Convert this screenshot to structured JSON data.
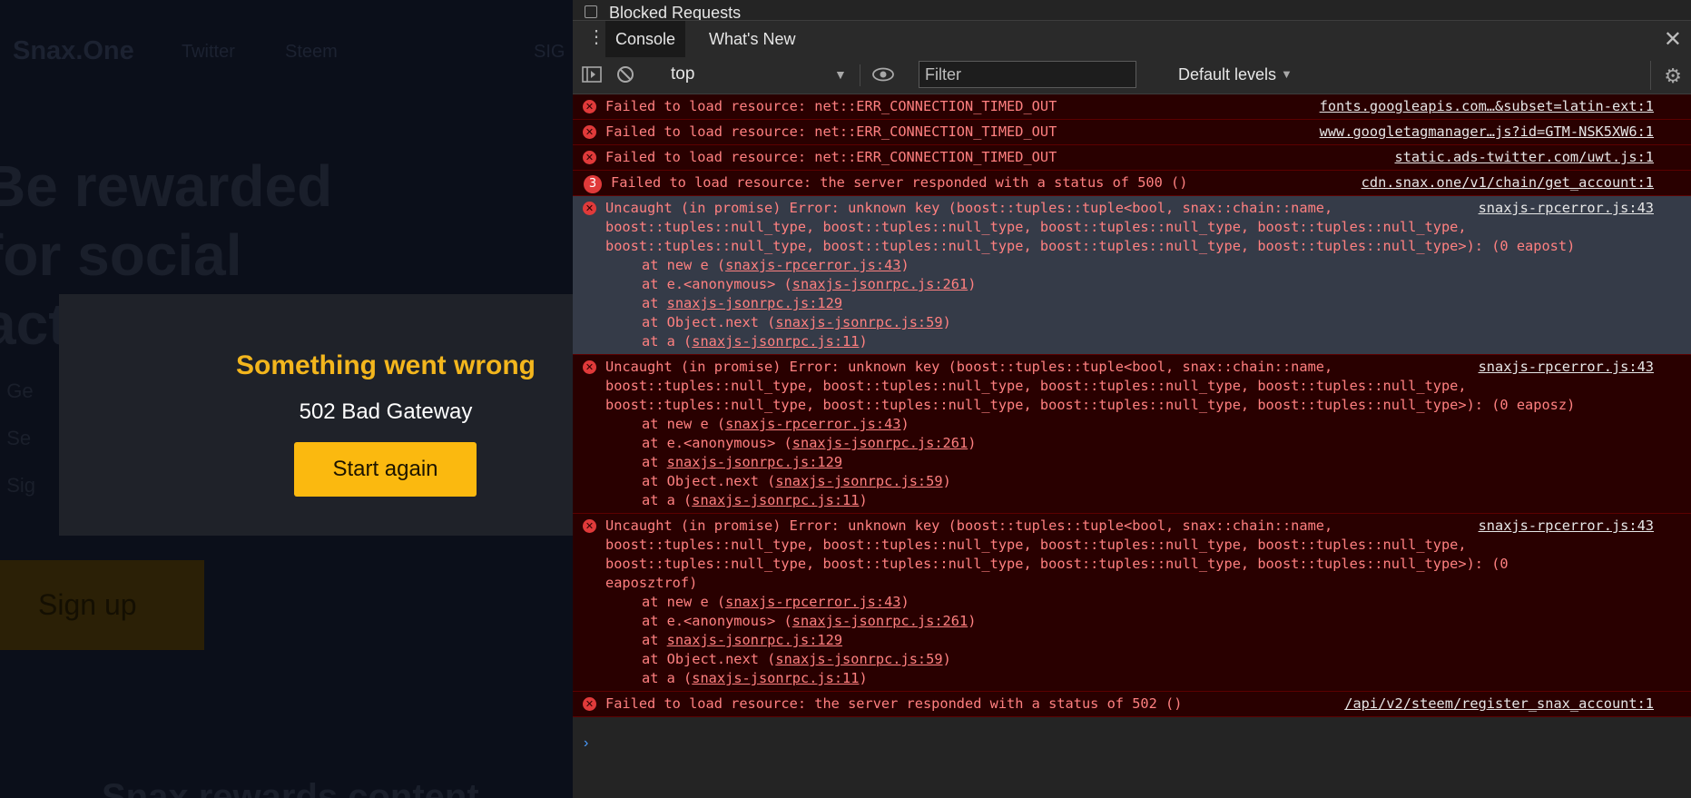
{
  "page": {
    "brand": "Snax.One",
    "nav": [
      "Twitter",
      "Steem",
      "SIG"
    ],
    "hero_lines": [
      "Be rewarded",
      "for social",
      "act"
    ],
    "bullets": [
      "Ge",
      "Se",
      "Sig"
    ],
    "signup_label": "Sign up",
    "bottom_text": "Snax rewards content"
  },
  "modal": {
    "title": "Something went wrong",
    "subtitle": "502 Bad Gateway",
    "button": "Start again"
  },
  "devtools": {
    "blocked_label": "Blocked Requests",
    "tabs": [
      "Console",
      "What's New"
    ],
    "context": "top",
    "filter_placeholder": "Filter",
    "levels": "Default levels",
    "messages": [
      {
        "text": "Failed to load resource: net::ERR_CONNECTION_TIMED_OUT",
        "source": "fonts.googleapis.com…&subset=latin-ext:1"
      },
      {
        "text": "Failed to load resource: net::ERR_CONNECTION_TIMED_OUT",
        "source": "www.googletagmanager…js?id=GTM-NSK5XW6:1"
      },
      {
        "text": "Failed to load resource: net::ERR_CONNECTION_TIMED_OUT",
        "source": "static.ads-twitter.com/uwt.js:1"
      },
      {
        "count": "3",
        "text": "Failed to load resource: the server responded with a status of 500 ()",
        "source": "cdn.snax.one/v1/chain/get_account:1"
      },
      {
        "text": "Uncaught (in promise) Error: unknown key (boost::tuples::tuple<bool, snax::chain::name,\nboost::tuples::null_type, boost::tuples::null_type, boost::tuples::null_type, boost::tuples::null_type,\nboost::tuples::null_type, boost::tuples::null_type, boost::tuples::null_type, boost::tuples::null_type>): (0 eapost)",
        "source": "snaxjs-rpcerror.js:43"
      },
      {
        "text": "Uncaught (in promise) Error: unknown key (boost::tuples::tuple<bool, snax::chain::name,\nboost::tuples::null_type, boost::tuples::null_type, boost::tuples::null_type, boost::tuples::null_type,\nboost::tuples::null_type, boost::tuples::null_type, boost::tuples::null_type, boost::tuples::null_type>): (0 eaposz)",
        "source": "snaxjs-rpcerror.js:43"
      },
      {
        "text": "Uncaught (in promise) Error: unknown key (boost::tuples::tuple<bool, snax::chain::name,\nboost::tuples::null_type, boost::tuples::null_type, boost::tuples::null_type, boost::tuples::null_type,\nboost::tuples::null_type, boost::tuples::null_type, boost::tuples::null_type, boost::tuples::null_type>): (0\neaposztrof)",
        "source": "snaxjs-rpcerror.js:43"
      },
      {
        "text": "Failed to load resource: the server responded with a status of 502 ()",
        "source": "/api/v2/steem/register_snax_account:1"
      }
    ],
    "stack": [
      {
        "pre": "at new e (",
        "link": "snaxjs-rpcerror.js:43",
        "post": ")"
      },
      {
        "pre": "at e.<anonymous> (",
        "link": "snaxjs-jsonrpc.js:261",
        "post": ")"
      },
      {
        "pre": "at ",
        "link": "snaxjs-jsonrpc.js:129",
        "post": ""
      },
      {
        "pre": "at Object.next (",
        "link": "snaxjs-jsonrpc.js:59",
        "post": ")"
      },
      {
        "pre": "at a (",
        "link": "snaxjs-jsonrpc.js:11",
        "post": ")"
      }
    ],
    "prompt": "›"
  },
  "colors": {
    "accent": "#fbb90f",
    "modal_title": "#f3b61d",
    "error_bg": "#290000",
    "error_text": "#ff8080"
  }
}
